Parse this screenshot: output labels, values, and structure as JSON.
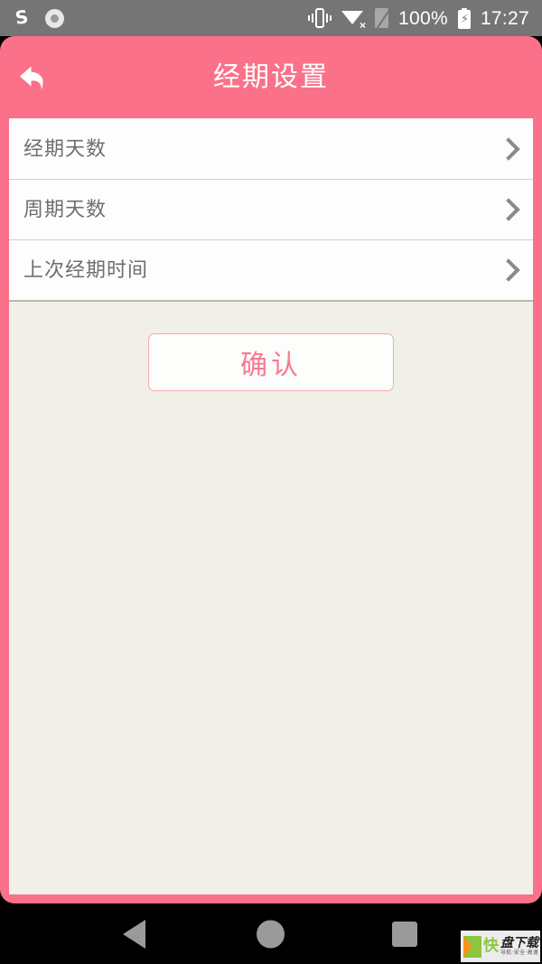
{
  "status_bar": {
    "left_icons": [
      {
        "name": "sogou-input-icon",
        "glyph": "S"
      },
      {
        "name": "recording-circle-icon",
        "glyph": "◉"
      }
    ],
    "right_icons": [
      {
        "name": "vibrate-icon"
      },
      {
        "name": "wifi-disconnected-icon"
      },
      {
        "name": "sim-card-off-icon"
      }
    ],
    "battery_percent": "100%",
    "time": "17:27"
  },
  "header": {
    "title": "经期设置",
    "back_icon": "back-arrow-icon",
    "background_color": "#fa7189",
    "title_color": "#ffffff"
  },
  "settings_list": {
    "rows": [
      {
        "label": "经期天数",
        "value": "",
        "chevron": "chevron-right-icon"
      },
      {
        "label": "周期天数",
        "value": "",
        "chevron": "chevron-right-icon"
      },
      {
        "label": "上次经期时间",
        "value": "",
        "chevron": "chevron-right-icon"
      }
    ]
  },
  "actions": {
    "confirm_label": "确认",
    "confirm_text_color": "#f8798f",
    "confirm_border_color": "#f6a6b4"
  },
  "content": {
    "background_color": "#f0f0e8"
  },
  "navigation_bar": {
    "back": "back-triangle-icon",
    "home": "home-circle-icon",
    "recents": "recents-square-icon"
  },
  "watermark": {
    "mark": "快",
    "title": "盘下载",
    "subtitle": "导航·安全·高速"
  }
}
